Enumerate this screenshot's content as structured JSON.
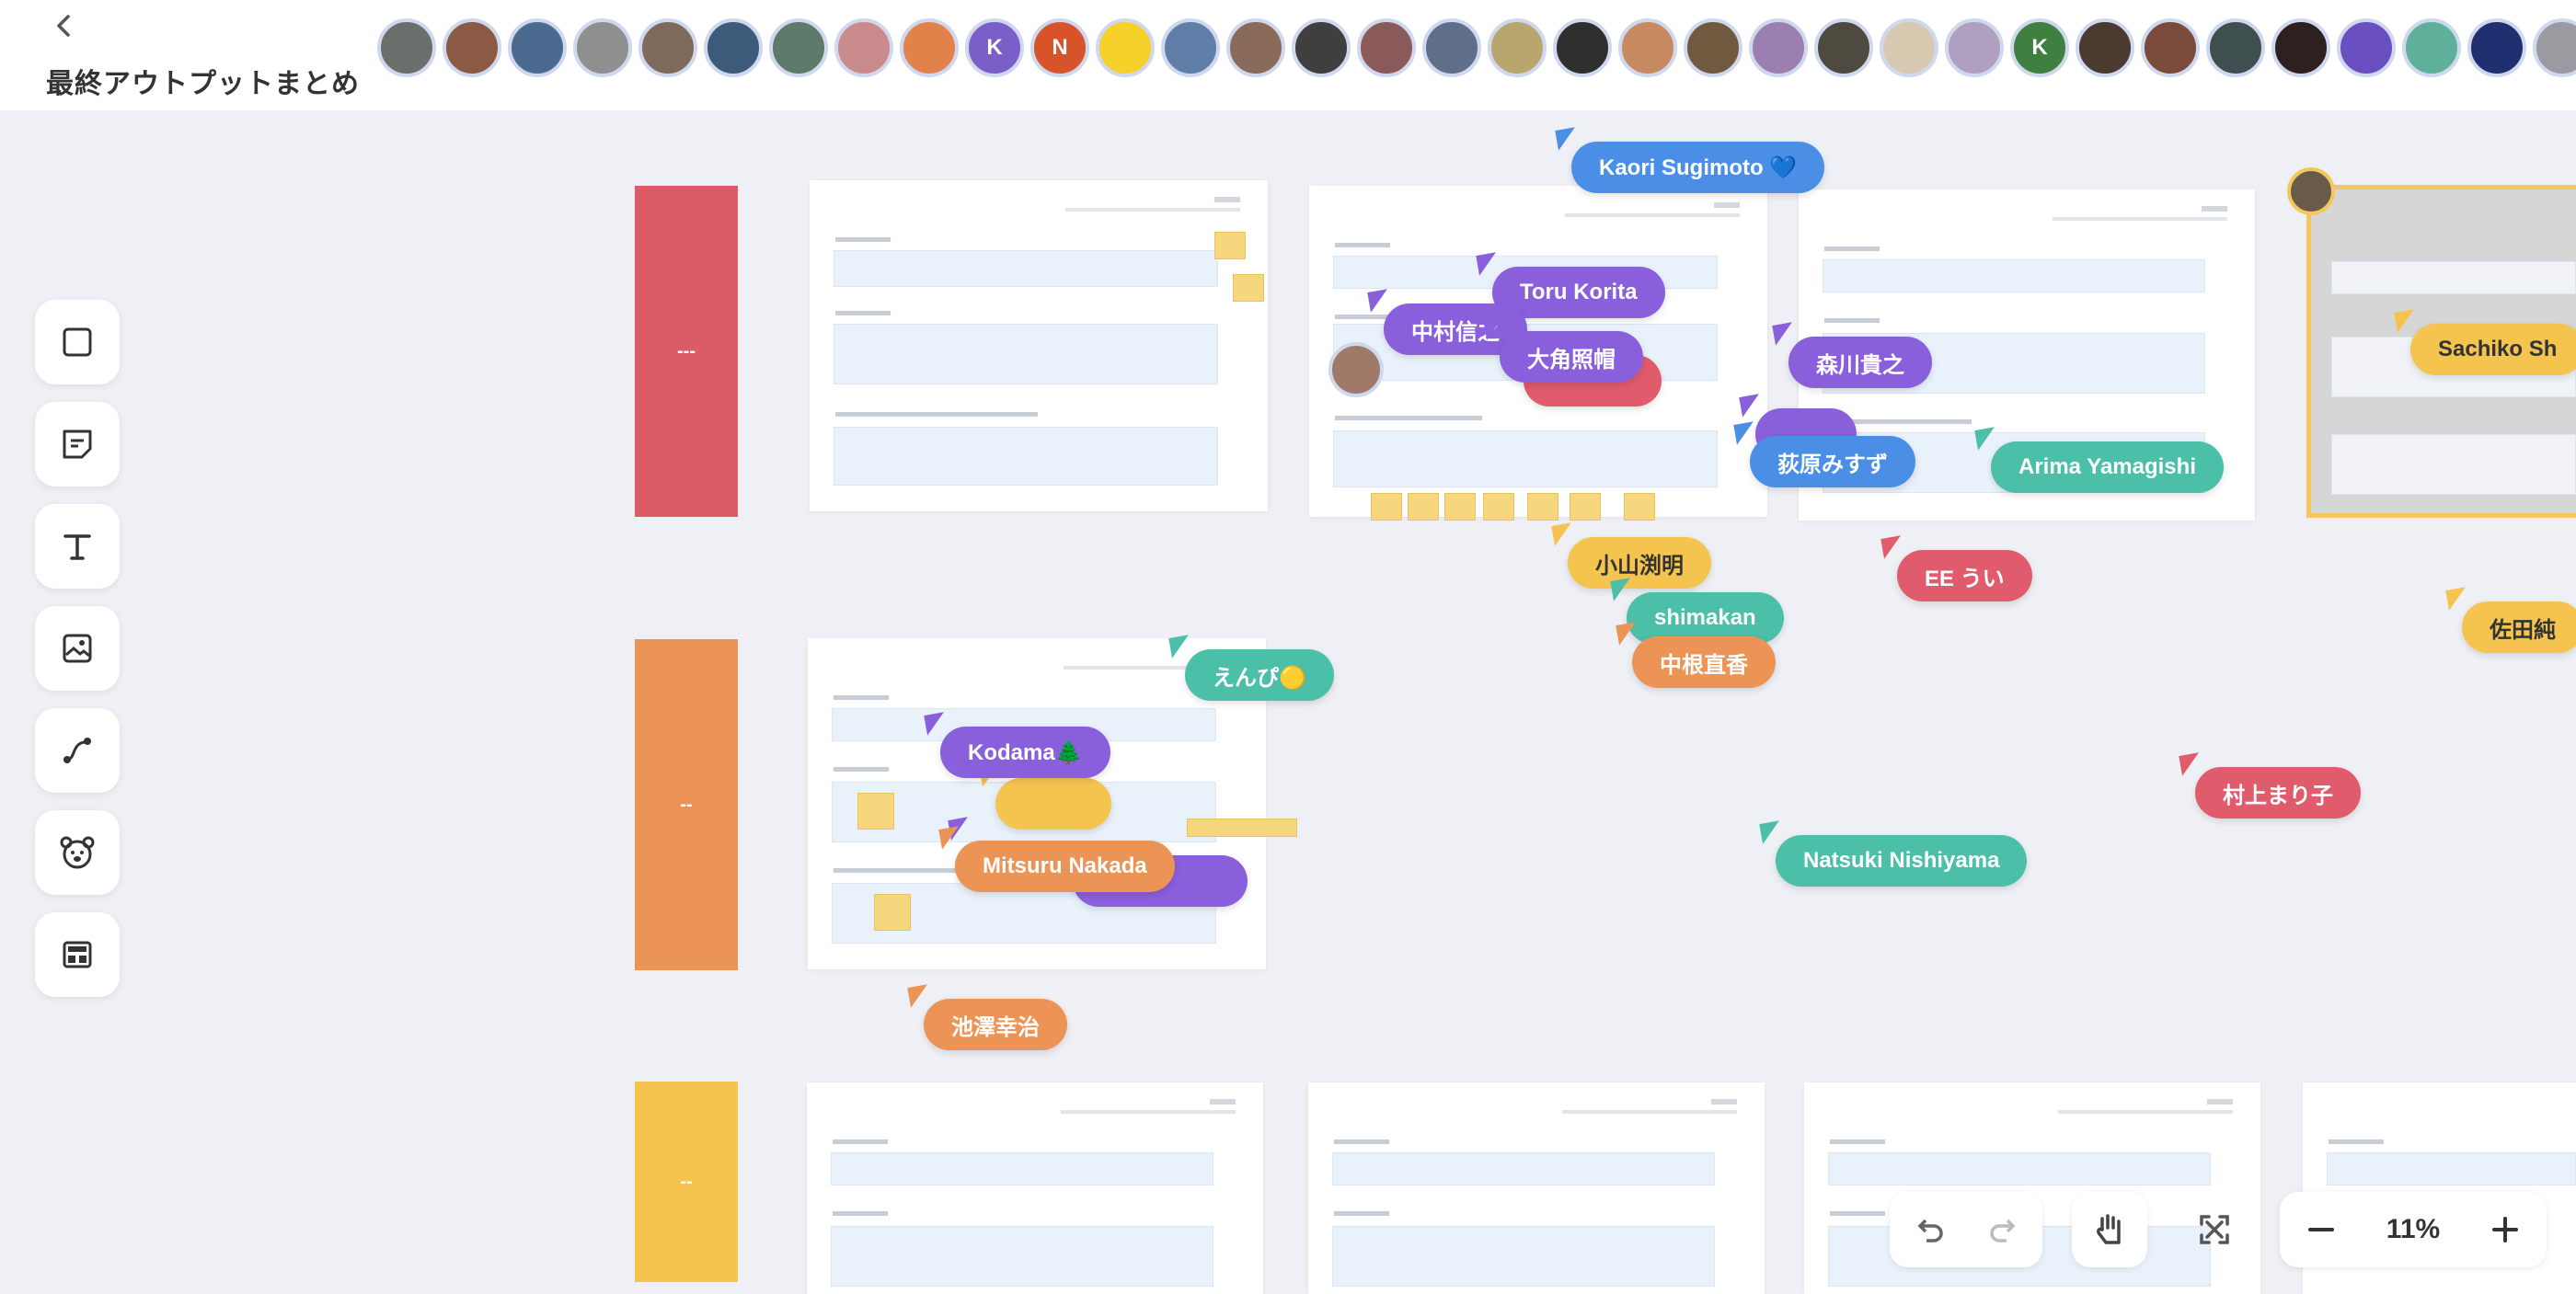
{
  "board": {
    "title": "最終アウトプットまとめ",
    "back_icon": "chevron-left-icon"
  },
  "avatars": [
    {
      "initial": "",
      "color": "#6b6f6b"
    },
    {
      "initial": "",
      "color": "#8a5a44"
    },
    {
      "initial": "",
      "color": "#4b6a8f"
    },
    {
      "initial": "",
      "color": "#8f8f8f"
    },
    {
      "initial": "",
      "color": "#7d6a5a"
    },
    {
      "initial": "",
      "color": "#3e5a7a"
    },
    {
      "initial": "",
      "color": "#5d7a6a"
    },
    {
      "initial": "",
      "color": "#c98b8b"
    },
    {
      "initial": "",
      "color": "#e0824a"
    },
    {
      "initial": "K",
      "color": "#7b5fc9"
    },
    {
      "initial": "N",
      "color": "#d7542b"
    },
    {
      "initial": "",
      "color": "#f5d12a"
    },
    {
      "initial": "",
      "color": "#5f7fa8"
    },
    {
      "initial": "",
      "color": "#8a6a58"
    },
    {
      "initial": "",
      "color": "#3f3f3f"
    },
    {
      "initial": "",
      "color": "#8a5a5a"
    },
    {
      "initial": "",
      "color": "#5f6f8a"
    },
    {
      "initial": "",
      "color": "#b9a66f"
    },
    {
      "initial": "",
      "color": "#2f2f2f"
    },
    {
      "initial": "",
      "color": "#c7895f"
    },
    {
      "initial": "",
      "color": "#6f5a3f"
    },
    {
      "initial": "",
      "color": "#9a7fb0"
    },
    {
      "initial": "",
      "color": "#4f4a3f"
    },
    {
      "initial": "",
      "color": "#d9c9b0"
    },
    {
      "initial": "",
      "color": "#b0a0c0"
    },
    {
      "initial": "K",
      "color": "#3f7f3f"
    },
    {
      "initial": "",
      "color": "#4a3a30"
    },
    {
      "initial": "",
      "color": "#7a4a3a"
    },
    {
      "initial": "",
      "color": "#3f4f4f"
    },
    {
      "initial": "",
      "color": "#2f2020"
    },
    {
      "initial": "",
      "color": "#6a4fc0"
    },
    {
      "initial": "",
      "color": "#5fb09a"
    },
    {
      "initial": "",
      "color": "#1f2f6f"
    },
    {
      "initial": "",
      "color": "#9a9aa0"
    },
    {
      "initial": "",
      "color": "#e8e0d0"
    }
  ],
  "toolbar": [
    {
      "name": "rectangle-tool-icon"
    },
    {
      "name": "sticky-note-tool-icon"
    },
    {
      "name": "text-tool-icon"
    },
    {
      "name": "image-tool-icon"
    },
    {
      "name": "connector-tool-icon"
    },
    {
      "name": "stamp-tool-icon"
    },
    {
      "name": "template-tool-icon"
    }
  ],
  "rows": [
    {
      "label": "---",
      "color": "#db5b67"
    },
    {
      "label": "--",
      "color": "#ec9456"
    },
    {
      "label": "--",
      "color": "#f4c44f"
    }
  ],
  "cursors": [
    {
      "name": "Kaori Sugimoto 💙",
      "color": "#4a8ee6"
    },
    {
      "name": "Toru Korita",
      "color": "#8a5fdb"
    },
    {
      "name": "中村信之",
      "color": "#8a5fdb"
    },
    {
      "name": "大角照帽",
      "color": "#8a5fdb"
    },
    {
      "name": "森川貴之",
      "color": "#8a5fdb"
    },
    {
      "name": "荻原みすず",
      "color": "#4a8ee6"
    },
    {
      "name": "Arima Yamagishi",
      "color": "#4bbfa8"
    },
    {
      "name": "Sachiko Sh",
      "color": "#f4c44f"
    },
    {
      "name": "小山渕明",
      "color": "#f4c44f"
    },
    {
      "name": "shimakan",
      "color": "#4bbfa8"
    },
    {
      "name": "中根直香",
      "color": "#ec9456"
    },
    {
      "name": "EE うい",
      "color": "#e05b6b"
    },
    {
      "name": "佐田純",
      "color": "#f4c44f"
    },
    {
      "name": "えんぴ🟡",
      "color": "#4bbfa8"
    },
    {
      "name": "Kodama🌲",
      "color": "#8a5fdb"
    },
    {
      "name": "Mitsuru Nakada",
      "color": "#ec9456"
    },
    {
      "name": "村上まり子",
      "color": "#e05b6b"
    },
    {
      "name": "Natsuki Nishiyama",
      "color": "#4bbfa8"
    },
    {
      "name": "池澤幸治",
      "color": "#ec9456"
    }
  ],
  "controls": {
    "undo_icon": "undo-icon",
    "redo_icon": "redo-icon",
    "hand_icon": "hand-icon",
    "fit_icon": "fit-screen-icon",
    "zoom_out_icon": "minus-icon",
    "zoom_in_icon": "plus-icon",
    "zoom_level": "11%"
  }
}
